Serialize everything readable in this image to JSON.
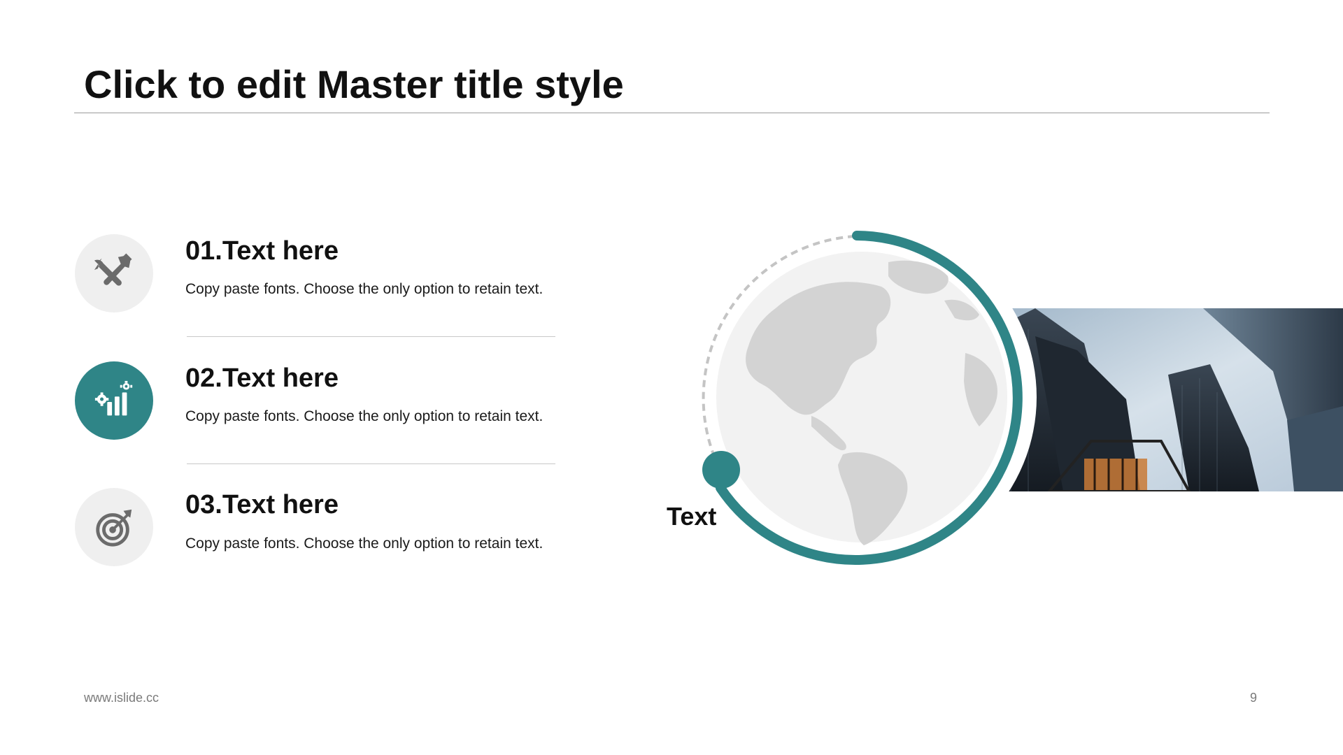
{
  "slide": {
    "title": "Click to edit Master title style",
    "footer_left": "www.islide.cc",
    "page_number": "9",
    "accent_color": "#2f8587"
  },
  "items": [
    {
      "title": "01.Text here",
      "description": "Copy paste fonts. Choose the only option to retain text.",
      "icon": "tools-icon",
      "highlighted": false
    },
    {
      "title": "02.Text here",
      "description": "Copy paste fonts. Choose the only option to retain text.",
      "icon": "gear-chart-icon",
      "highlighted": true
    },
    {
      "title": "03.Text here",
      "description": "Copy paste fonts. Choose the only option to retain text.",
      "icon": "target-icon",
      "highlighted": false
    }
  ],
  "visual": {
    "label": "Text",
    "globe_icon": "globe-icon",
    "photo_icon": "city-skyscrapers-image"
  }
}
